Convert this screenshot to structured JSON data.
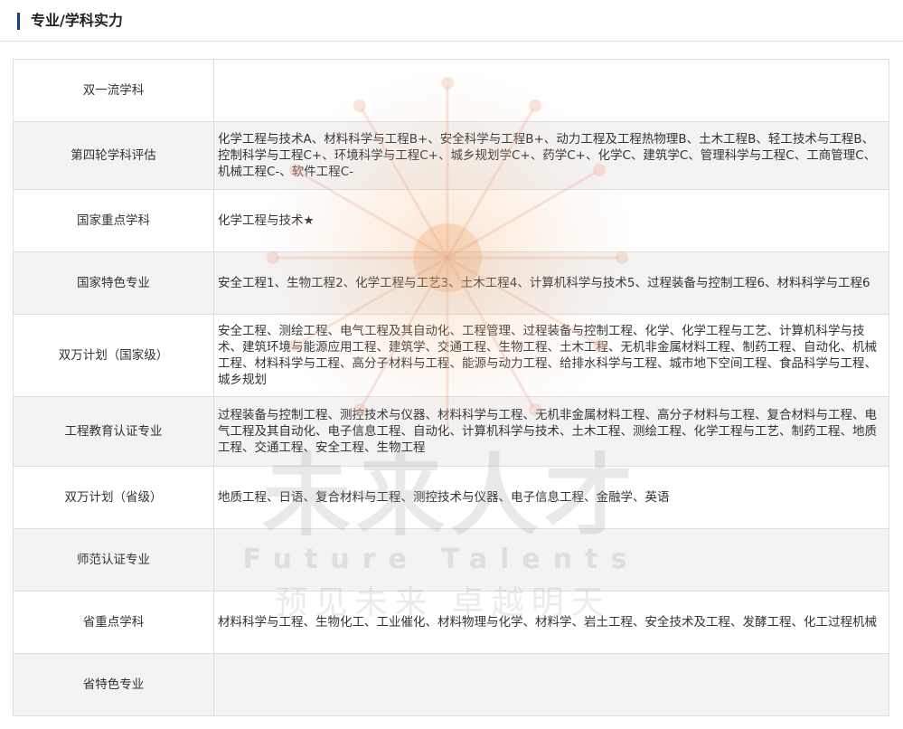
{
  "section": {
    "title": "专业/学科实力"
  },
  "rows": [
    {
      "label": "双一流学科",
      "value": ""
    },
    {
      "label": "第四轮学科评估",
      "value": "化学工程与技术A、材料科学与工程B+、安全科学与工程B+、动力工程及工程热物理B、土木工程B、轻工技术与工程B、控制科学与工程C+、环境科学与工程C+、城乡规划学C+、药学C+、化学C、建筑学C、管理科学与工程C、工商管理C、机械工程C-、软件工程C-"
    },
    {
      "label": "国家重点学科",
      "value": "化学工程与技术★"
    },
    {
      "label": "国家特色专业",
      "value": "安全工程1、生物工程2、化学工程与工艺3、土木工程4、计算机科学与技术5、过程装备与控制工程6、材料科学与工程6"
    },
    {
      "label": "双万计划（国家级）",
      "value": "安全工程、测绘工程、电气工程及其自动化、工程管理、过程装备与控制工程、化学、化学工程与工艺、计算机科学与技术、建筑环境与能源应用工程、建筑学、交通工程、生物工程、土木工程、无机非金属材料工程、制药工程、自动化、机械工程、材料科学与工程、高分子材料与工程、能源与动力工程、给排水科学与工程、城市地下空间工程、食品科学与工程、城乡规划"
    },
    {
      "label": "工程教育认证专业",
      "value": "过程装备与控制工程、测控技术与仪器、材料科学与工程、无机非金属材料工程、高分子材料与工程、复合材料与工程、电气工程及其自动化、电子信息工程、自动化、计算机科学与技术、土木工程、测绘工程、化学工程与工艺、制药工程、地质工程、交通工程、安全工程、生物工程"
    },
    {
      "label": "双万计划（省级）",
      "value": "地质工程、日语、复合材料与工程、测控技术与仪器、电子信息工程、金融学、英语"
    },
    {
      "label": "师范认证专业",
      "value": ""
    },
    {
      "label": "省重点学科",
      "value": "材料科学与工程、生物化工、工业催化、材料物理与化学、材料学、岩土工程、安全技术及工程、发酵工程、化工过程机械"
    },
    {
      "label": "省特色专业",
      "value": ""
    }
  ],
  "watermark": {
    "main": "未来人才",
    "english": "Future Talents",
    "slogan": "预见未来 卓越明天"
  },
  "colors": {
    "accent_bar": "#1c3f7c",
    "row_alt": "#eeeeee",
    "border": "#dedede"
  }
}
